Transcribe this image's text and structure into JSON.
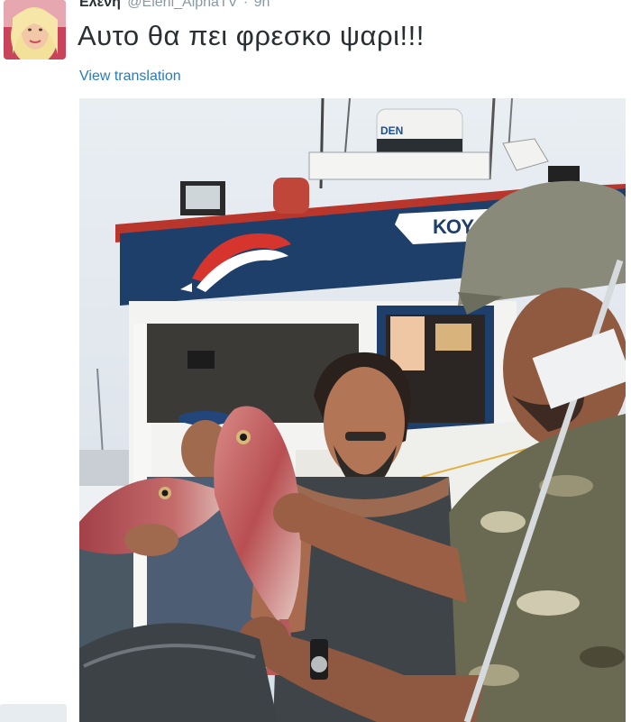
{
  "tweet": {
    "author_name": "Ελενη",
    "handle": "@Eleni_AlphaTV",
    "separator": "·",
    "time": "9h",
    "text": "Αυτο θα πει φρεσκο ψαρι!!!",
    "translate_link": "View translation"
  },
  "photo": {
    "boat_name": "ΚΟΥΛΑ Φ",
    "radar_label": "DEN",
    "icons": {
      "avatar": "avatar-blonde-woman",
      "dolphin": "dolphin-emblem-icon"
    }
  },
  "colors": {
    "link": "#2b7bb9",
    "text": "#292f33",
    "muted": "#8899a6",
    "boat_hull": "#1f3f6b",
    "boat_red": "#c83a2c"
  }
}
